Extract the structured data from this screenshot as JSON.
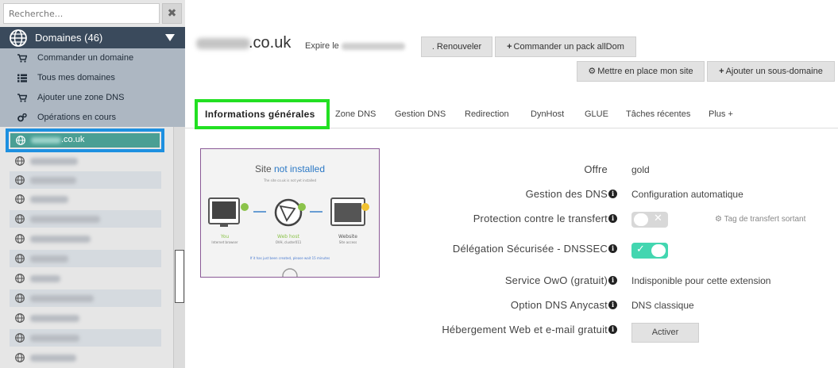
{
  "search": {
    "placeholder": "Recherche...",
    "clear_glyph": "✖"
  },
  "sidebar": {
    "header": {
      "title": "Domaines (46)",
      "icon": "globe-icon"
    },
    "actions": [
      {
        "label": "Commander un domaine",
        "icon": "cart-icon"
      },
      {
        "label": "Tous mes domaines",
        "icon": "list-icon"
      },
      {
        "label": "Ajouter une zone DNS",
        "icon": "cart-icon"
      },
      {
        "label": "Opérations en cours",
        "icon": "cogs-icon"
      }
    ],
    "active_domain": {
      "label": ".co.uk"
    }
  },
  "domain": {
    "name": ".co.uk",
    "expire_label": "Expire le"
  },
  "toolbar": {
    "renew": ". Renouveler",
    "order_pack": "Commander un pack allDom",
    "setup_site": "Mettre en place mon site",
    "add_subdomain": "Ajouter un sous-domaine"
  },
  "tabs": [
    {
      "label": "Informations générales"
    },
    {
      "label": "Zone DNS"
    },
    {
      "label": "Gestion DNS"
    },
    {
      "label": "Redirection"
    },
    {
      "label": "DynHost"
    },
    {
      "label": "GLUE"
    },
    {
      "label": "Tâches récentes"
    },
    {
      "label": "Plus +"
    }
  ],
  "preview": {
    "title_prefix": "Site ",
    "title_accent": "not installed",
    "subtitle": "The site co.uk is not yet installed",
    "you": "You",
    "you_sub": "Internet browser",
    "host": "Web host",
    "host_sub": "OVH, cluster011",
    "website": "Website",
    "website_sub": "Site access",
    "note": "If it has just been created, please wait 15 minutes"
  },
  "info": {
    "offer": {
      "label": "Offre",
      "value": "gold"
    },
    "dns_mgmt": {
      "label": "Gestion des DNS",
      "value": "Configuration automatique"
    },
    "transfer": {
      "label": "Protection contre le transfert",
      "tag": "Tag de transfert sortant",
      "enabled": false
    },
    "dnssec": {
      "label": "Délégation Sécurisée - DNSSEC",
      "enabled": true
    },
    "owo": {
      "label": "Service OwO (gratuit)",
      "value": "Indisponible pour cette extension"
    },
    "anycast": {
      "label": "Option DNS Anycast",
      "value": "DNS classique"
    },
    "hosting": {
      "label": "Hébergement Web et e-mail gratuit",
      "button": "Activer"
    }
  },
  "colors": {
    "sidebar_header": "#3a4a5c",
    "active_domain": "#4a9f94",
    "highlight_blue": "#1e90e0",
    "highlight_green": "#22e022",
    "toggle_on": "#43d6b0"
  }
}
